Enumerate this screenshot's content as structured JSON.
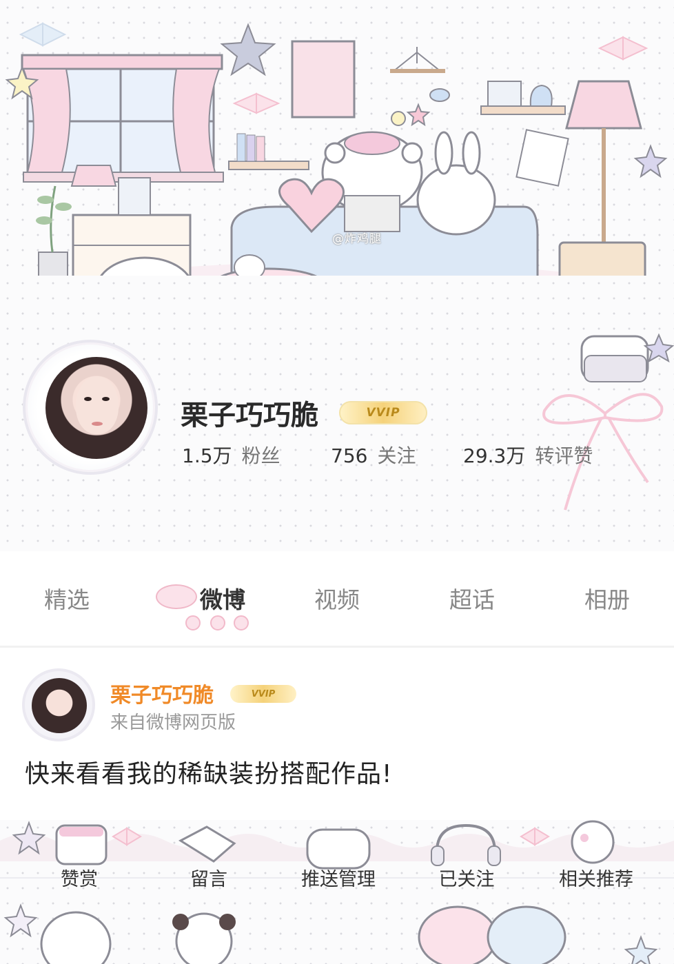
{
  "banner": {
    "watermark": "@炸鸡腿"
  },
  "profile": {
    "username": "栗子巧巧脆",
    "vip_badge": "VVIP",
    "stats": [
      {
        "value": "1.5万",
        "label": "粉丝"
      },
      {
        "value": "756",
        "label": "关注"
      },
      {
        "value": "29.3万",
        "label": "转评赞"
      }
    ]
  },
  "tabs": [
    {
      "label": "精选",
      "active": false
    },
    {
      "label": "微博",
      "active": true
    },
    {
      "label": "视频",
      "active": false
    },
    {
      "label": "超话",
      "active": false
    },
    {
      "label": "相册",
      "active": false
    }
  ],
  "post": {
    "author": "栗子巧巧脆",
    "vip_badge": "VVIP",
    "source": "来自微博网页版",
    "text": "快来看看我的稀缺装扮搭配作品!"
  },
  "actions": [
    {
      "label": "赞赏",
      "icon": "gift-box-icon"
    },
    {
      "label": "留言",
      "icon": "message-icon"
    },
    {
      "label": "推送管理",
      "icon": "push-icon"
    },
    {
      "label": "已关注",
      "icon": "headphones-icon"
    },
    {
      "label": "相关推荐",
      "icon": "recommend-icon"
    }
  ],
  "colors": {
    "accent_orange": "#f08a28",
    "pink": "#f6c9d6",
    "lavender": "#c9c6e6"
  }
}
